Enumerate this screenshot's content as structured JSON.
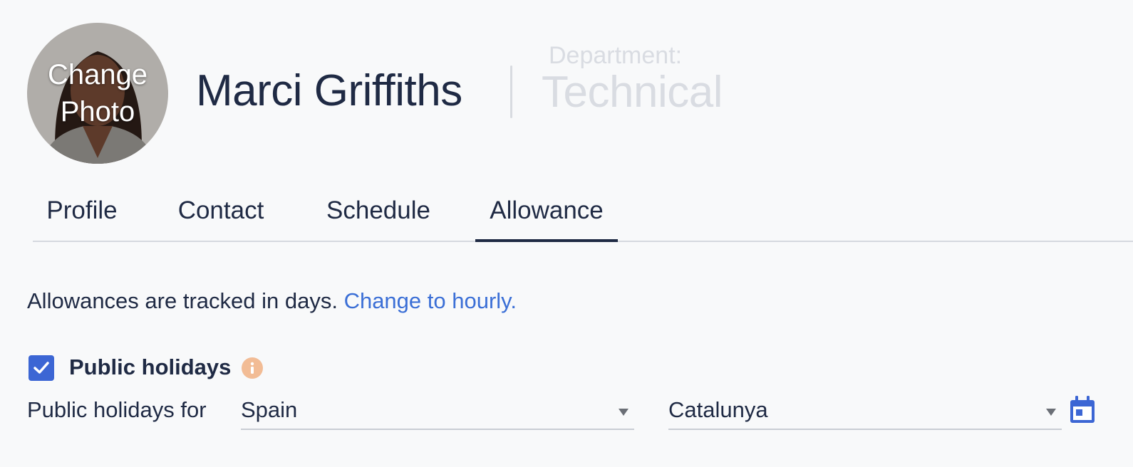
{
  "header": {
    "avatar_overlay": "Change\nPhoto",
    "employee_name": "Marci Griffiths",
    "department_label": "Department:",
    "department_value": "Technical"
  },
  "tabs": [
    {
      "label": "Profile",
      "active": false
    },
    {
      "label": "Contact",
      "active": false
    },
    {
      "label": "Schedule",
      "active": false
    },
    {
      "label": "Allowance",
      "active": true
    }
  ],
  "allowance": {
    "tracking_text": "Allowances are tracked in days.",
    "tracking_link": "Change to hourly.",
    "public_holidays": {
      "checked": true,
      "label": "Public holidays",
      "info_icon": "info-icon",
      "for_label": "Public holidays for",
      "country": "Spain",
      "region": "Catalunya",
      "calendar_icon": "calendar-icon"
    }
  },
  "colors": {
    "primary_text": "#1f2a44",
    "link": "#3b6fd6",
    "checkbox": "#3c66d4",
    "info": "#f2bc95",
    "muted": "#d9dce2",
    "background": "#f8f9fa"
  }
}
